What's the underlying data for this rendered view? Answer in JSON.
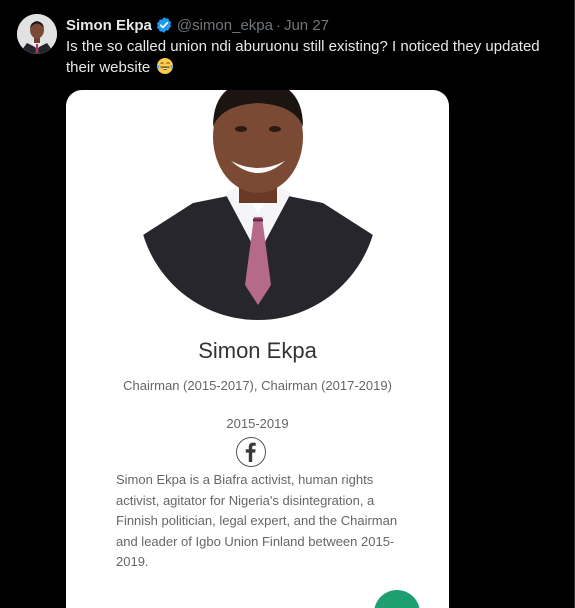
{
  "author": {
    "display_name": "Simon Ekpa",
    "handle": "@simon_ekpa",
    "separator": "·",
    "timestamp": "Jun 27",
    "verified_icon": "verified-badge-icon",
    "verified_color": "#1d9bf0"
  },
  "tweet": {
    "text": "Is the so called union ndi aburuonu still existing? I noticed they updated their website",
    "emoji": "😂"
  },
  "card": {
    "name": "Simon Ekpa",
    "role": "Chairman (2015-2017), Chairman (2017-2019)",
    "years": "2015-2019",
    "social_icon": "facebook-icon",
    "bio": "Simon Ekpa is a Biafra activist, human rights activist, agitator for Nigeria's disintegration, a Finnish politician, legal expert, and the Chairman and leader of Igbo Union Finland between 2015-2019.",
    "accent_color": "#1e9f72"
  },
  "colors": {
    "background": "#000000",
    "primary_text": "#e7e9ea",
    "secondary_text": "#71767b",
    "card_background": "#ffffff"
  }
}
